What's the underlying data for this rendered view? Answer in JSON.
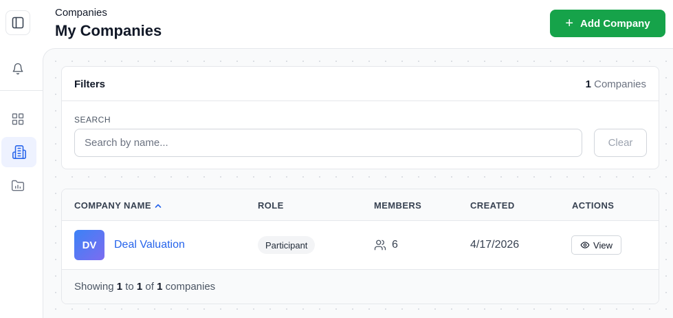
{
  "header": {
    "breadcrumb": "Companies",
    "title": "My Companies",
    "add_button": "Add Company"
  },
  "filters": {
    "title": "Filters",
    "count_number": "1",
    "count_label": " Companies",
    "search_label": "SEARCH",
    "search_placeholder": "Search by name...",
    "search_value": "",
    "clear_button": "Clear"
  },
  "table": {
    "columns": [
      "COMPANY NAME",
      "ROLE",
      "MEMBERS",
      "CREATED",
      "ACTIONS"
    ],
    "sort_column": "COMPANY NAME",
    "sort_direction": "ascending",
    "rows": [
      {
        "initials": "DV",
        "name": "Deal Valuation",
        "role": "Participant",
        "members": "6",
        "created": "4/17/2026",
        "action": "View"
      }
    ],
    "footer": {
      "prefix": "Showing ",
      "from": "1",
      "to_word": " to ",
      "to": "1",
      "of_word": " of ",
      "total": "1",
      "suffix": " companies"
    }
  },
  "sidebar": {
    "items": [
      "toggle-sidebar",
      "notifications",
      "dashboard",
      "companies",
      "folders"
    ],
    "active": "companies"
  },
  "colors": {
    "accent": "#16a34a",
    "link": "#2563eb",
    "active_bg": "#eef2ff"
  }
}
